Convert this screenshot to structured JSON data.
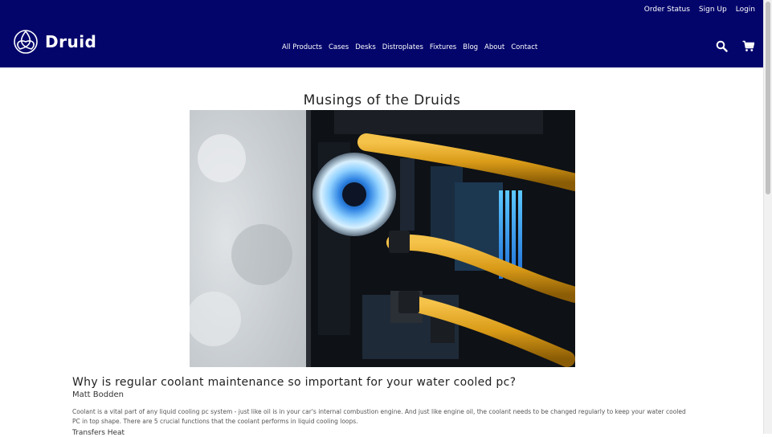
{
  "brand": {
    "name": "Druid",
    "logo_icon": "celtic-triquetra-icon",
    "bar_color": "#03056b"
  },
  "top_links": [
    "Order Status",
    "Sign Up",
    "Login"
  ],
  "nav": [
    "All Products",
    "Cases",
    "Desks",
    "Distroplates",
    "Fixtures",
    "Blog",
    "About",
    "Contact"
  ],
  "header_icons": {
    "search": "search-icon",
    "cart": "cart-icon"
  },
  "page": {
    "title": "Musings of the Druids"
  },
  "hero_image": {
    "subject": "water-cooled-pc-interior-photo"
  },
  "post": {
    "title": "Why is regular coolant maintenance so important for your water cooled pc?",
    "author": "Matt Bodden",
    "body": "Coolant is a vital part of any liquid cooling pc system - just like oil is in your car's internal combustion engine. And just like engine oil, the coolant needs to be changed regularly to keep your water cooled PC in top shape. There are 5 crucial functions that the coolant performs in liquid cooling loops.",
    "next_heading": "Transfers Heat"
  }
}
